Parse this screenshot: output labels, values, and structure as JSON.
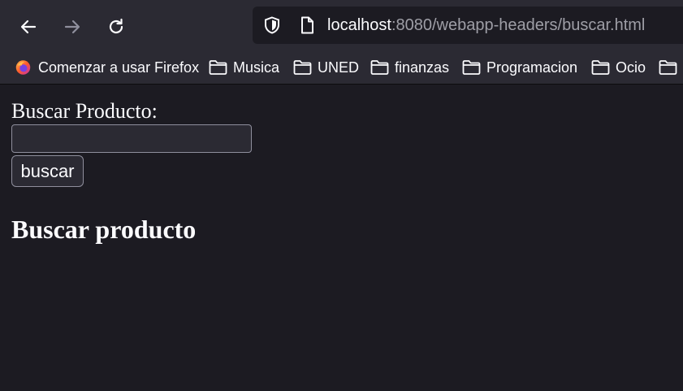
{
  "browser": {
    "url_host": "localhost",
    "url_rest": ":8080/webapp-headers/buscar.html",
    "bookmarks": [
      {
        "label": "Comenzar a usar Firefox",
        "icon": "firefox-icon"
      },
      {
        "label": "Musica",
        "icon": "folder-icon"
      },
      {
        "label": "UNED",
        "icon": "folder-icon"
      },
      {
        "label": "finanzas",
        "icon": "folder-icon"
      },
      {
        "label": "Programacion",
        "icon": "folder-icon"
      },
      {
        "label": "Ocio",
        "icon": "folder-icon"
      }
    ]
  },
  "page": {
    "search_label": "Buscar Producto:",
    "search_value": "",
    "search_button": "buscar",
    "heading": "Buscar producto"
  },
  "colors": {
    "toolbar": "#2b2a33",
    "background": "#1c1b22",
    "text": "#fbfbfe"
  }
}
